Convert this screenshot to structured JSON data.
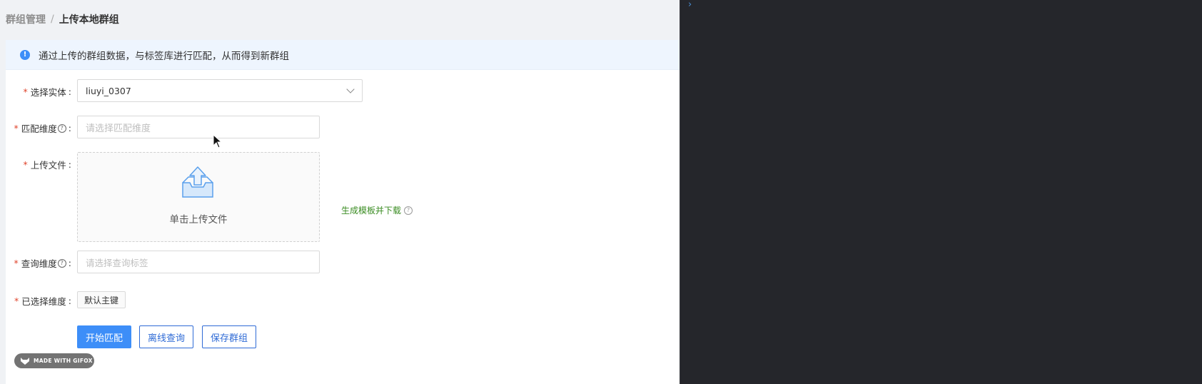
{
  "breadcrumb": {
    "parent": "群组管理",
    "separator": "/",
    "current": "上传本地群组"
  },
  "alert": {
    "text": "通过上传的群组数据，与标签库进行匹配，从而得到新群组"
  },
  "form": {
    "required_mark": "*",
    "entity": {
      "label": "选择实体",
      "colon": ":",
      "value": "liuyi_0307"
    },
    "match_dimension": {
      "label": "匹配维度",
      "colon": ":",
      "placeholder": "请选择匹配维度"
    },
    "upload": {
      "label": "上传文件",
      "colon": ":",
      "text": "单击上传文件"
    },
    "template_link": "生成模板并下载",
    "query_dimension": {
      "label": "查询维度",
      "colon": ":",
      "placeholder": "请选择查询标签"
    },
    "selected_dimension": {
      "label": "已选择维度",
      "colon": ":",
      "tag": "默认主键"
    },
    "help_glyph": "?"
  },
  "buttons": {
    "start_match": "开始匹配",
    "offline_query": "离线查询",
    "save_group": "保存群组"
  },
  "alert_glyph": "!",
  "console": {
    "caret": "›"
  },
  "watermark": "MADE WITH GIFOX",
  "colors": {
    "primary": "#3d8ef8",
    "link_green": "#3a8c22",
    "required_red": "#e0442c",
    "console_bg": "#25262b"
  }
}
